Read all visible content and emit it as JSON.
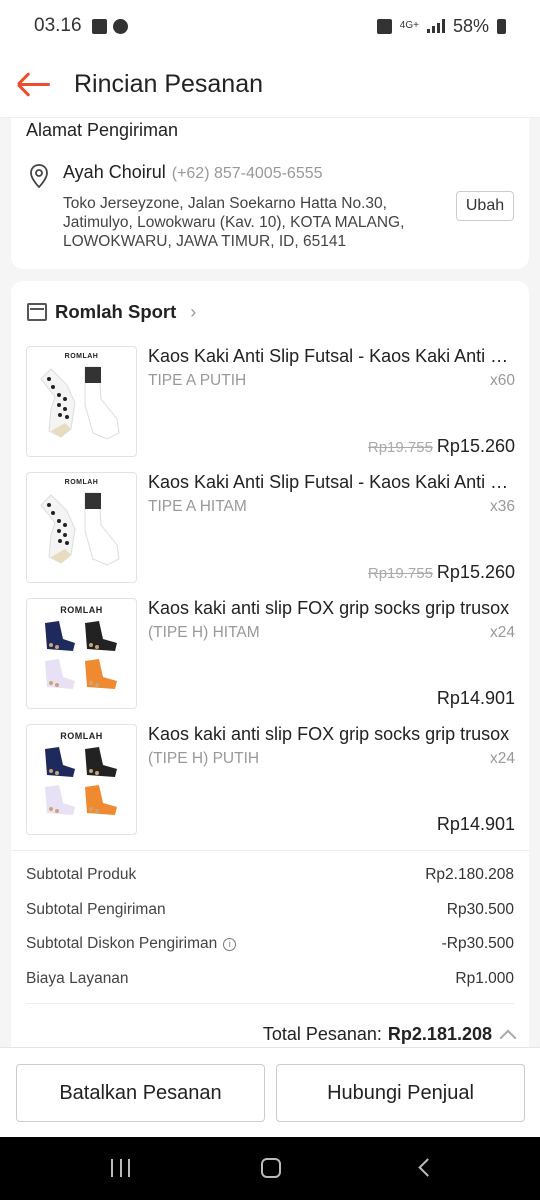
{
  "status_bar": {
    "time": "03.16",
    "network": "4G+",
    "battery": "58%"
  },
  "header": {
    "title": "Rincian Pesanan"
  },
  "address": {
    "section_title": "Alamat Pengiriman",
    "name": "Ayah Choirul",
    "phone": "(+62) 857-4005-6555",
    "line1": "Toko Jerseyzone, Jalan Soekarno Hatta No.30,",
    "line2": "Jatimulyo, Lowokwaru (Kav. 10), KOTA MALANG,",
    "line3": "LOWOKWARU, JAWA TIMUR, ID, 65141",
    "change_label": "Ubah"
  },
  "shop": {
    "name": "Romlah Sport"
  },
  "items": [
    {
      "name": "Kaos Kaki Anti Slip Futsal - Kaos Kaki Anti Slip Sepak Bola",
      "variant": "TIPE A PUTIH",
      "qty": "x60",
      "original_price": "Rp19.755",
      "price": "Rp15.260",
      "brand": "ROMLAH"
    },
    {
      "name": "Kaos Kaki Anti Slip Futsal - Kaos Kaki Anti Slip Sepak Bola",
      "variant": "TIPE A HITAM",
      "qty": "x36",
      "original_price": "Rp19.755",
      "price": "Rp15.260",
      "brand": "ROMLAH"
    },
    {
      "name": "Kaos kaki anti slip FOX grip socks grip trusox",
      "variant": "(TIPE H) HITAM",
      "qty": "x24",
      "original_price": "",
      "price": "Rp14.901",
      "brand": "ROMLAH"
    },
    {
      "name": "Kaos kaki anti slip FOX grip socks grip trusox",
      "variant": "(TIPE H) PUTIH",
      "qty": "x24",
      "original_price": "",
      "price": "Rp14.901",
      "brand": "ROMLAH"
    }
  ],
  "summary": {
    "subtotal_product_label": "Subtotal Produk",
    "subtotal_product": "Rp2.180.208",
    "subtotal_shipping_label": "Subtotal Pengiriman",
    "subtotal_shipping": "Rp30.500",
    "shipping_discount_label": "Subtotal Diskon Pengiriman",
    "shipping_discount": "-Rp30.500",
    "service_fee_label": "Biaya Layanan",
    "service_fee": "Rp1.000",
    "total_label": "Total Pesanan:",
    "total": "Rp2.181.208"
  },
  "actions": {
    "cancel_label": "Batalkan Pesanan",
    "contact_label": "Hubungi Penjual"
  },
  "colors": {
    "accent": "#ee4d2d",
    "background": "#f5f5f5"
  }
}
